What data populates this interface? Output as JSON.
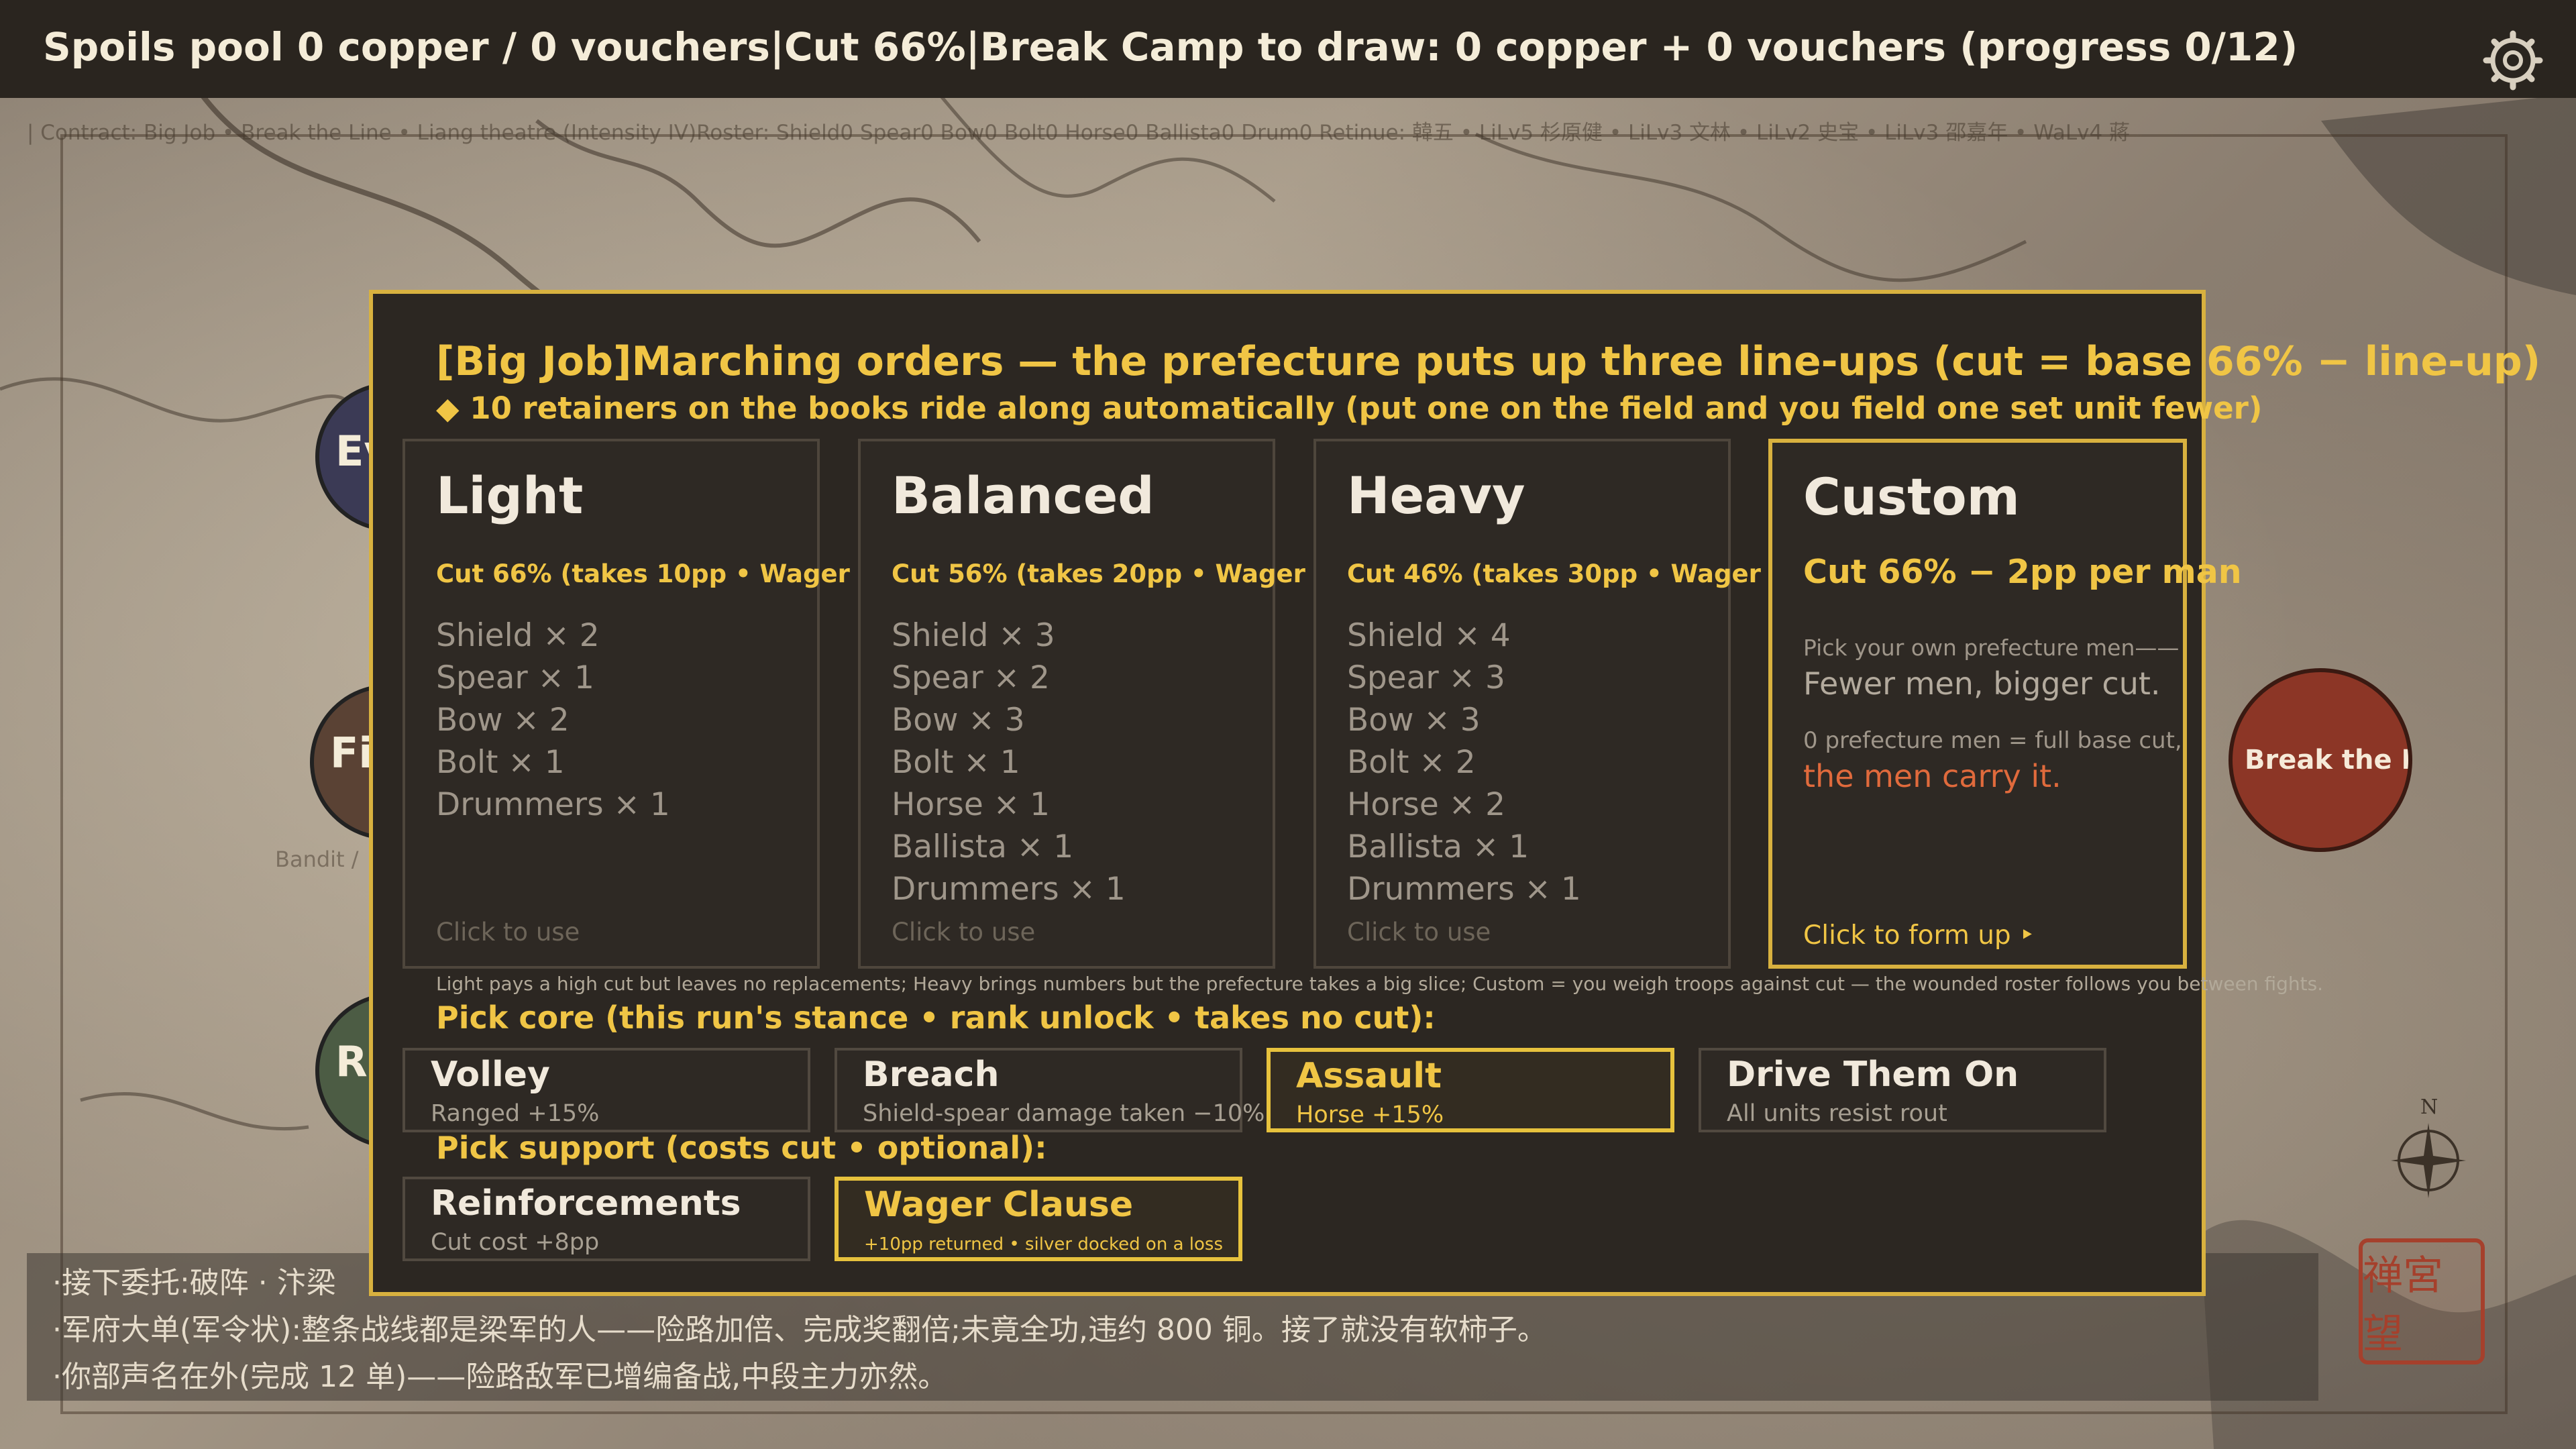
{
  "topbar": {
    "status": "Spoils pool 0 copper / 0 vouchers|Cut 66%|Break Camp to draw: 0 copper + 0 vouchers (progress 0/12)",
    "settings_icon": "gear-icon"
  },
  "map": {
    "contract_line": "| Contract: Big Job • Break the Line • Liang theatre (Intensity IV)Roster: Shield0 Spear0 Bow0 Bolt0 Horse0 Ballista0 Drum0 Retinue: 韓五 • LiLv5 杉原健 • LiLv3 文林 • LiLv2 史宝 • LiLv3 邵嘉年 • WaLv4 蔣",
    "nodes": {
      "ev": "Ev",
      "fi": "Fig",
      "r": "R",
      "break": "Break the Li"
    },
    "bandit_label": "Bandit /",
    "compass_letter": "N",
    "seal_text": "禅宮 望"
  },
  "log": {
    "lines": [
      "·接下委托:破阵 · 汴梁",
      "·军府大单(军令状):整条战线都是梁军的人——险路加倍、完成奖翻倍;未竟全功,违约 800 铜。接了就没有软柿子。",
      "·你部声名在外(完成 12 单)——险路敌军已增编备战,中段主力亦然。"
    ]
  },
  "modal": {
    "title": "[Big Job]Marching orders — the prefecture puts up three line-ups (cut = base 66% − line-up)",
    "subtitle": "◆ 10 retainers on the books ride along automatically (put one on the field and you field one set unit fewer)",
    "lineups": [
      {
        "name": "Light",
        "cut": "Cut 66% (takes 10pp • Wager",
        "units": [
          "Shield × 2",
          "Spear × 1",
          "Bow × 2",
          "Bolt × 1",
          "Drummers × 1"
        ],
        "foot": "Click to use"
      },
      {
        "name": "Balanced",
        "cut": "Cut 56% (takes 20pp • Wager",
        "units": [
          "Shield × 3",
          "Spear × 2",
          "Bow × 3",
          "Bolt × 1",
          "Horse × 1",
          "Ballista × 1",
          "Drummers × 1"
        ],
        "foot": "Click to use"
      },
      {
        "name": "Heavy",
        "cut": "Cut 46% (takes 30pp • Wager",
        "units": [
          "Shield × 4",
          "Spear × 3",
          "Bow × 3",
          "Bolt × 2",
          "Horse × 2",
          "Ballista × 1",
          "Drummers × 1"
        ],
        "foot": "Click to use"
      }
    ],
    "custom": {
      "name": "Custom",
      "cut": "Cut 66% − 2pp per man",
      "p1": "Pick your own prefecture men——",
      "p2": "Fewer men, bigger cut.",
      "p3": "0 prefecture men = full base cut,",
      "p4": "the men carry it.",
      "foot": "Click to form up ‣"
    },
    "note": "Light pays a high cut but leaves no replacements; Heavy brings numbers but the prefecture takes a big slice; Custom = you weigh troops against cut — the wounded roster follows you between fights.",
    "core_label": "Pick core (this run's stance • rank unlock • takes no cut):",
    "core_options": [
      {
        "name": "Volley",
        "desc": "Ranged +15%",
        "selected": false
      },
      {
        "name": "Breach",
        "desc": "Shield-spear damage taken −10%",
        "selected": false
      },
      {
        "name": "Assault",
        "desc": "Horse +15%",
        "selected": true
      },
      {
        "name": "Drive Them On",
        "desc": "All units resist rout",
        "selected": false
      }
    ],
    "support_label": "Pick support (costs cut • optional):",
    "support_options": [
      {
        "name": "Reinforcements",
        "desc": "Cut cost +8pp",
        "selected": false
      },
      {
        "name": "Wager Clause",
        "desc": "+10pp returned  •  silver docked on a loss",
        "selected": true
      }
    ]
  },
  "colors": {
    "accent": "#f0c545",
    "warning": "#e06a3c",
    "modal_bg": "#2c2722",
    "topbar_bg": "#2a251f"
  }
}
